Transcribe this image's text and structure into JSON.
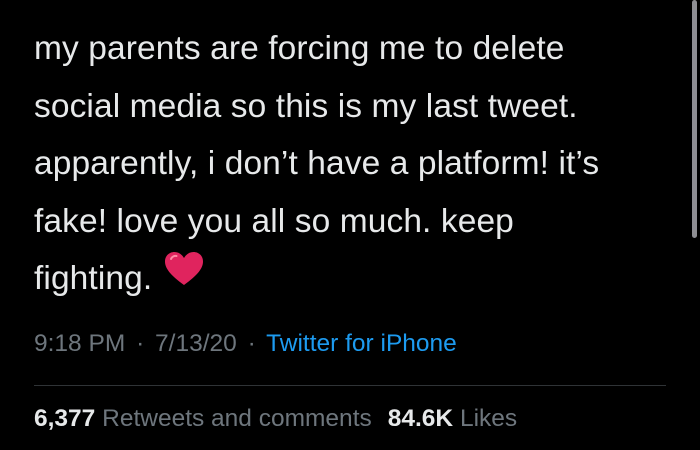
{
  "tweet": {
    "lines": [
      "my parents are forcing me to delete",
      "social media so this is my last tweet.",
      "apparently, i don’t have a platform! it’s",
      "fake! love you all so much. keep",
      "fighting."
    ],
    "emoji": "heart-emoji"
  },
  "meta": {
    "time": "9:18 PM",
    "separator": "·",
    "date": "7/13/20",
    "source": "Twitter for iPhone"
  },
  "stats": {
    "retweets_count": "6,377",
    "retweets_label": "Retweets and comments",
    "likes_count": "84.6K",
    "likes_label": "Likes"
  },
  "colors": {
    "background": "#000000",
    "text": "#e7e9ea",
    "muted": "#6e767d",
    "link": "#1d9bf0",
    "heart": "#e0245e"
  }
}
